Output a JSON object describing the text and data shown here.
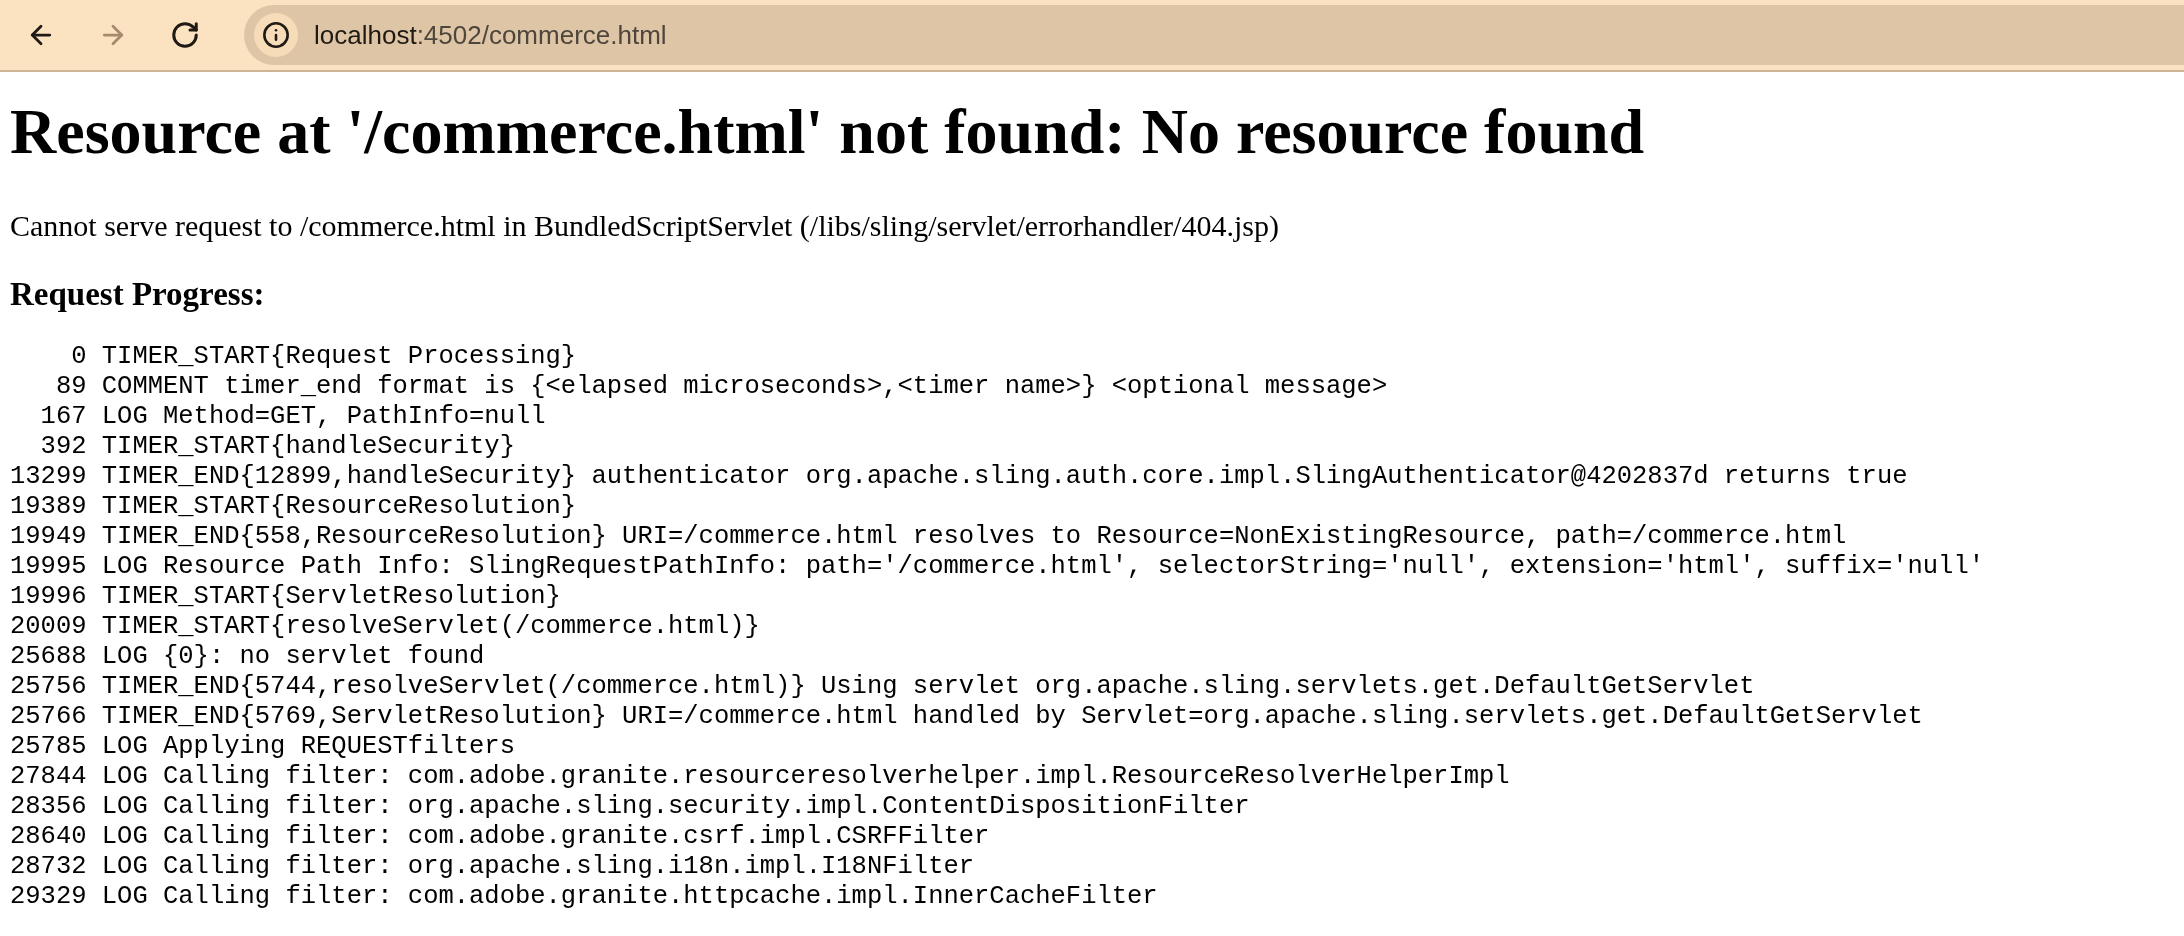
{
  "browser": {
    "nav_buttons": [
      {
        "kind": "back",
        "disabled": false
      },
      {
        "kind": "forward",
        "disabled": true
      },
      {
        "kind": "reload",
        "disabled": false
      }
    ],
    "url_host": "localhost",
    "url_rest": ":4502/commerce.html"
  },
  "page": {
    "title": "Resource at '/commerce.html' not found: No resource found",
    "message": "Cannot serve request to /commerce.html in BundledScriptServlet (/libs/sling/servlet/errorhandler/404.jsp)",
    "progress_heading": "Request Progress:",
    "log": [
      {
        "time": "0",
        "text": "TIMER_START{Request Processing}"
      },
      {
        "time": "89",
        "text": "COMMENT timer_end format is {<elapsed microseconds>,<timer name>} <optional message>"
      },
      {
        "time": "167",
        "text": "LOG Method=GET, PathInfo=null"
      },
      {
        "time": "392",
        "text": "TIMER_START{handleSecurity}"
      },
      {
        "time": "13299",
        "text": "TIMER_END{12899,handleSecurity} authenticator org.apache.sling.auth.core.impl.SlingAuthenticator@4202837d returns true"
      },
      {
        "time": "19389",
        "text": "TIMER_START{ResourceResolution}"
      },
      {
        "time": "19949",
        "text": "TIMER_END{558,ResourceResolution} URI=/commerce.html resolves to Resource=NonExistingResource, path=/commerce.html"
      },
      {
        "time": "19995",
        "text": "LOG Resource Path Info: SlingRequestPathInfo: path='/commerce.html', selectorString='null', extension='html', suffix='null'"
      },
      {
        "time": "19996",
        "text": "TIMER_START{ServletResolution}"
      },
      {
        "time": "20009",
        "text": "TIMER_START{resolveServlet(/commerce.html)}"
      },
      {
        "time": "25688",
        "text": "LOG {0}: no servlet found"
      },
      {
        "time": "25756",
        "text": "TIMER_END{5744,resolveServlet(/commerce.html)} Using servlet org.apache.sling.servlets.get.DefaultGetServlet"
      },
      {
        "time": "25766",
        "text": "TIMER_END{5769,ServletResolution} URI=/commerce.html handled by Servlet=org.apache.sling.servlets.get.DefaultGetServlet"
      },
      {
        "time": "25785",
        "text": "LOG Applying REQUESTfilters"
      },
      {
        "time": "27844",
        "text": "LOG Calling filter: com.adobe.granite.resourceresolverhelper.impl.ResourceResolverHelperImpl"
      },
      {
        "time": "28356",
        "text": "LOG Calling filter: org.apache.sling.security.impl.ContentDispositionFilter"
      },
      {
        "time": "28640",
        "text": "LOG Calling filter: com.adobe.granite.csrf.impl.CSRFFilter"
      },
      {
        "time": "28732",
        "text": "LOG Calling filter: org.apache.sling.i18n.impl.I18NFilter"
      },
      {
        "time": "29329",
        "text": "LOG Calling filter: com.adobe.granite.httpcache.impl.InnerCacheFilter"
      }
    ]
  }
}
